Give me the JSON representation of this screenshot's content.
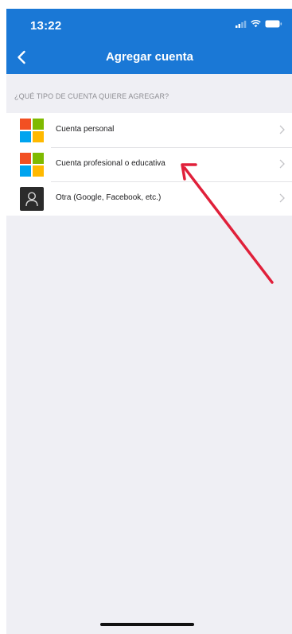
{
  "status_bar": {
    "time": "13:22"
  },
  "nav": {
    "title": "Agregar cuenta",
    "back_icon": "chevron-left-icon"
  },
  "section": {
    "header": "¿QUÉ TIPO DE CUENTA QUIERE AGREGAR?"
  },
  "accounts": [
    {
      "label": "Cuenta personal",
      "icon": "microsoft-logo-icon"
    },
    {
      "label": "Cuenta profesional o educativa",
      "icon": "microsoft-logo-icon"
    },
    {
      "label": "Otra (Google, Facebook, etc.)",
      "icon": "user-icon"
    }
  ],
  "colors": {
    "header_blue": "#1a78d6",
    "background": "#efeff4",
    "ms_red": "#f25022",
    "ms_green": "#7fba00",
    "ms_blue": "#00a4ef",
    "ms_yellow": "#ffb900",
    "annotation_arrow": "#e0203a"
  }
}
